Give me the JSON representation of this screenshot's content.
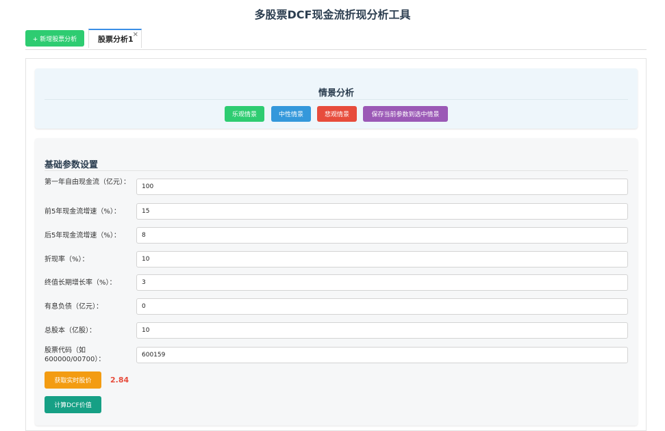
{
  "page": {
    "title": "多股票DCF现金流折现分析工具"
  },
  "tabs": {
    "add_label": "+ 新增股票分析",
    "active_label": "股票分析1",
    "close_glyph": "×"
  },
  "scenario": {
    "heading": "情景分析",
    "optimistic": "乐观情景",
    "neutral": "中性情景",
    "pessimistic": "悲观情景",
    "save": "保存当前参数到选中情景",
    "colors": {
      "optimistic": "#2ecc71",
      "neutral": "#3498db",
      "pessimistic": "#e74c3c",
      "save": "#9b59b6"
    }
  },
  "params": {
    "heading": "基础参数设置",
    "fields": [
      {
        "label": "第一年自由现金流（亿元）：",
        "value": "100"
      },
      {
        "label": "前5年现金流增速（%）：",
        "value": "15"
      },
      {
        "label": "后5年现金流增速（%）：",
        "value": "8"
      },
      {
        "label": "折现率（%）：",
        "value": "10"
      },
      {
        "label": "终值长期增长率（%）：",
        "value": "3"
      },
      {
        "label": "有息负债（亿元）：",
        "value": "0"
      },
      {
        "label": "总股本（亿股）：",
        "value": "10"
      },
      {
        "label": "股票代码（如600000/00700）：",
        "value": "600159"
      }
    ],
    "fetch_label": "获取实时股价",
    "price": "2.84",
    "calc_label": "计算DCF价值"
  }
}
